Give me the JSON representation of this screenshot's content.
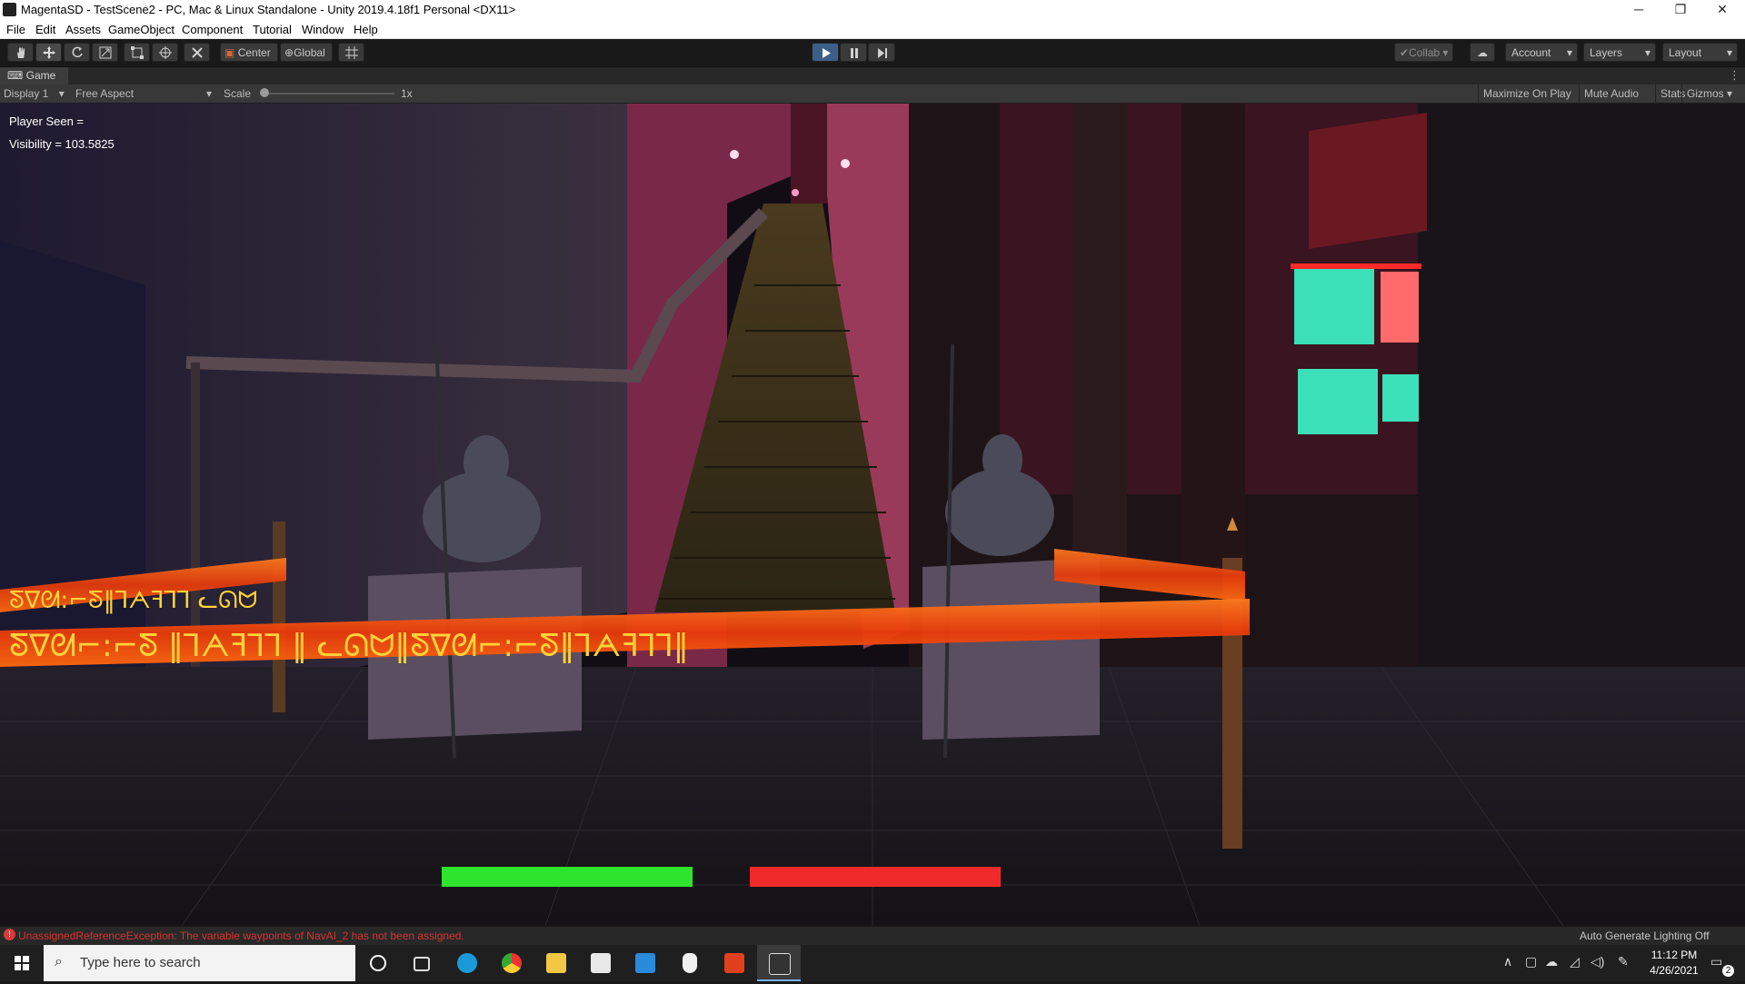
{
  "window": {
    "title": "MagentaSD - TestScene2 - PC, Mac & Linux Standalone - Unity 2019.4.18f1 Personal <DX11>",
    "controls": {
      "minimize": "─",
      "maximize": "❐",
      "close": "✕"
    }
  },
  "menu": [
    "File",
    "Edit",
    "Assets",
    "GameObject",
    "Component",
    "Tutorial",
    "Window",
    "Help"
  ],
  "toolbar": {
    "tools": [
      "hand-tool-icon",
      "move-tool-icon",
      "rotate-tool-icon",
      "scale-tool-icon",
      "rect-tool-icon",
      "transform-tool-icon",
      "custom-tool-icon"
    ],
    "pivot_label": "Center",
    "space_label": "Global",
    "collab_label": "Collab",
    "account_label": "Account",
    "layers_label": "Layers",
    "layout_label": "Layout",
    "play_active": true
  },
  "game_tab": {
    "label": "Game",
    "display": "Display 1",
    "aspect": "Free Aspect",
    "scale_label": "Scale",
    "scale_value": "1x",
    "scale_level": 0.0,
    "toggles": [
      "Maximize On Play",
      "Mute Audio",
      "Stats",
      "Gizmos"
    ]
  },
  "hud": {
    "player_seen": "Player Seen =",
    "visibility": "Visibility = 103.5825",
    "green_bar_color": "#2ee52e",
    "red_bar_color": "#f02a2a"
  },
  "scene": {
    "tape_glyphs": "ᘕ∇ᘛ⌐:⌐ᘕ ‖⅂ᗅꟻ⅂Ꞁ ‖ ᓚᘏᗢ‖ᘕ∇ᘛ⌐:⌐ᘕ‖⅂ᗅꟻ⅂Ꞁ‖",
    "tape_glyphs_short": "ᘕ∇ᘛ:⌐ᘕ‖⅂ᗅꟻ⅂Ꞁ ᓚᘏᗢ"
  },
  "status": {
    "error_text": "UnassignedReferenceException: The variable waypoints of NavAI_2 has not been assigned.",
    "lighting_text": "Auto Generate Lighting Off"
  },
  "taskbar": {
    "search_placeholder": "Type here to search",
    "apps": [
      "cortana-icon",
      "task-view-icon",
      "edge-icon",
      "chrome-icon",
      "file-explorer-icon",
      "store-icon",
      "mail-icon",
      "alienware-icon",
      "office-icon",
      "unity-icon"
    ],
    "time": "11:12 PM",
    "date": "4/26/2021",
    "notification_count": "2"
  }
}
